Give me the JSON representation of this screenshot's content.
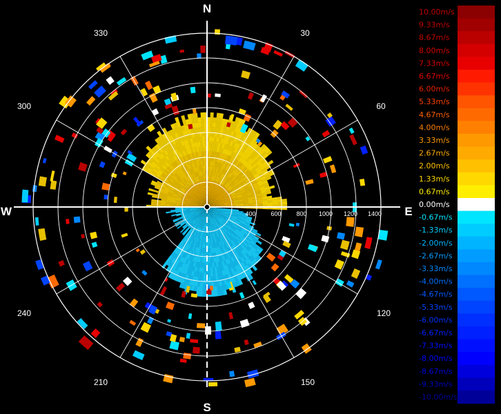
{
  "chart_data": {
    "type": "polar-radial-velocity",
    "compass": {
      "north": "N",
      "east": "E",
      "south": "S",
      "west": "W"
    },
    "azimuth_labels": [
      "30",
      "60",
      "120",
      "150",
      "210",
      "240",
      "300",
      "330"
    ],
    "range_labels": [
      "400",
      "600",
      "800",
      "1000",
      "1200",
      "1400"
    ],
    "colorbar": {
      "labels": [
        "10.00m/s",
        "9.33m/s",
        "8.67m/s",
        "8.00m/s",
        "7.33m/s",
        "6.67m/s",
        "6.00m/s",
        "5.33m/s",
        "4.67m/s",
        "4.00m/s",
        "3.33m/s",
        "2.67m/s",
        "2.00m/s",
        "1.33m/s",
        "0.67m/s",
        "0.00m/s",
        "-0.67m/s",
        "-1.33m/s",
        "-2.00m/s",
        "-2.67m/s",
        "-3.33m/s",
        "-4.00m/s",
        "-4.67m/s",
        "-5.33m/s",
        "-6.00m/s",
        "-6.67m/s",
        "-7.33m/s",
        "-8.00m/s",
        "-8.67m/s",
        "-9.33m/s",
        "-10.00m/s"
      ],
      "colors": [
        "#8b0000",
        "#a00000",
        "#bb0000",
        "#d40000",
        "#e80000",
        "#ff1a00",
        "#ff3300",
        "#ff5500",
        "#ff6a00",
        "#ff8000",
        "#ff9900",
        "#ffaa00",
        "#ffc000",
        "#ffd800",
        "#ffee00",
        "#ffffff",
        "#00e5ff",
        "#00ccff",
        "#00b4ff",
        "#009cff",
        "#0088ff",
        "#0070ff",
        "#0058ff",
        "#0044ff",
        "#0030ff",
        "#0020ff",
        "#0010ff",
        "#0000ff",
        "#0000dd",
        "#0000bb",
        "#000099"
      ],
      "label_colors": [
        "#c00000",
        "#c00000",
        "#c00000",
        "#d40000",
        "#d40000",
        "#e00000",
        "#e82000",
        "#ff4000",
        "#ff6000",
        "#ff8000",
        "#ff9900",
        "#ffaa00",
        "#ffc000",
        "#ffd800",
        "#ffee00",
        "#ffffff",
        "#00e5ff",
        "#00ccff",
        "#00b4ff",
        "#009cff",
        "#0088ff",
        "#0070ff",
        "#0058ff",
        "#0044ff",
        "#0030ff",
        "#0020ff",
        "#0010ff",
        "#0000ff",
        "#0000dd",
        "#0000bb",
        "#000099"
      ]
    },
    "accent_colors": {
      "approaching": "#00ccff",
      "receding": "#e8c000"
    }
  }
}
